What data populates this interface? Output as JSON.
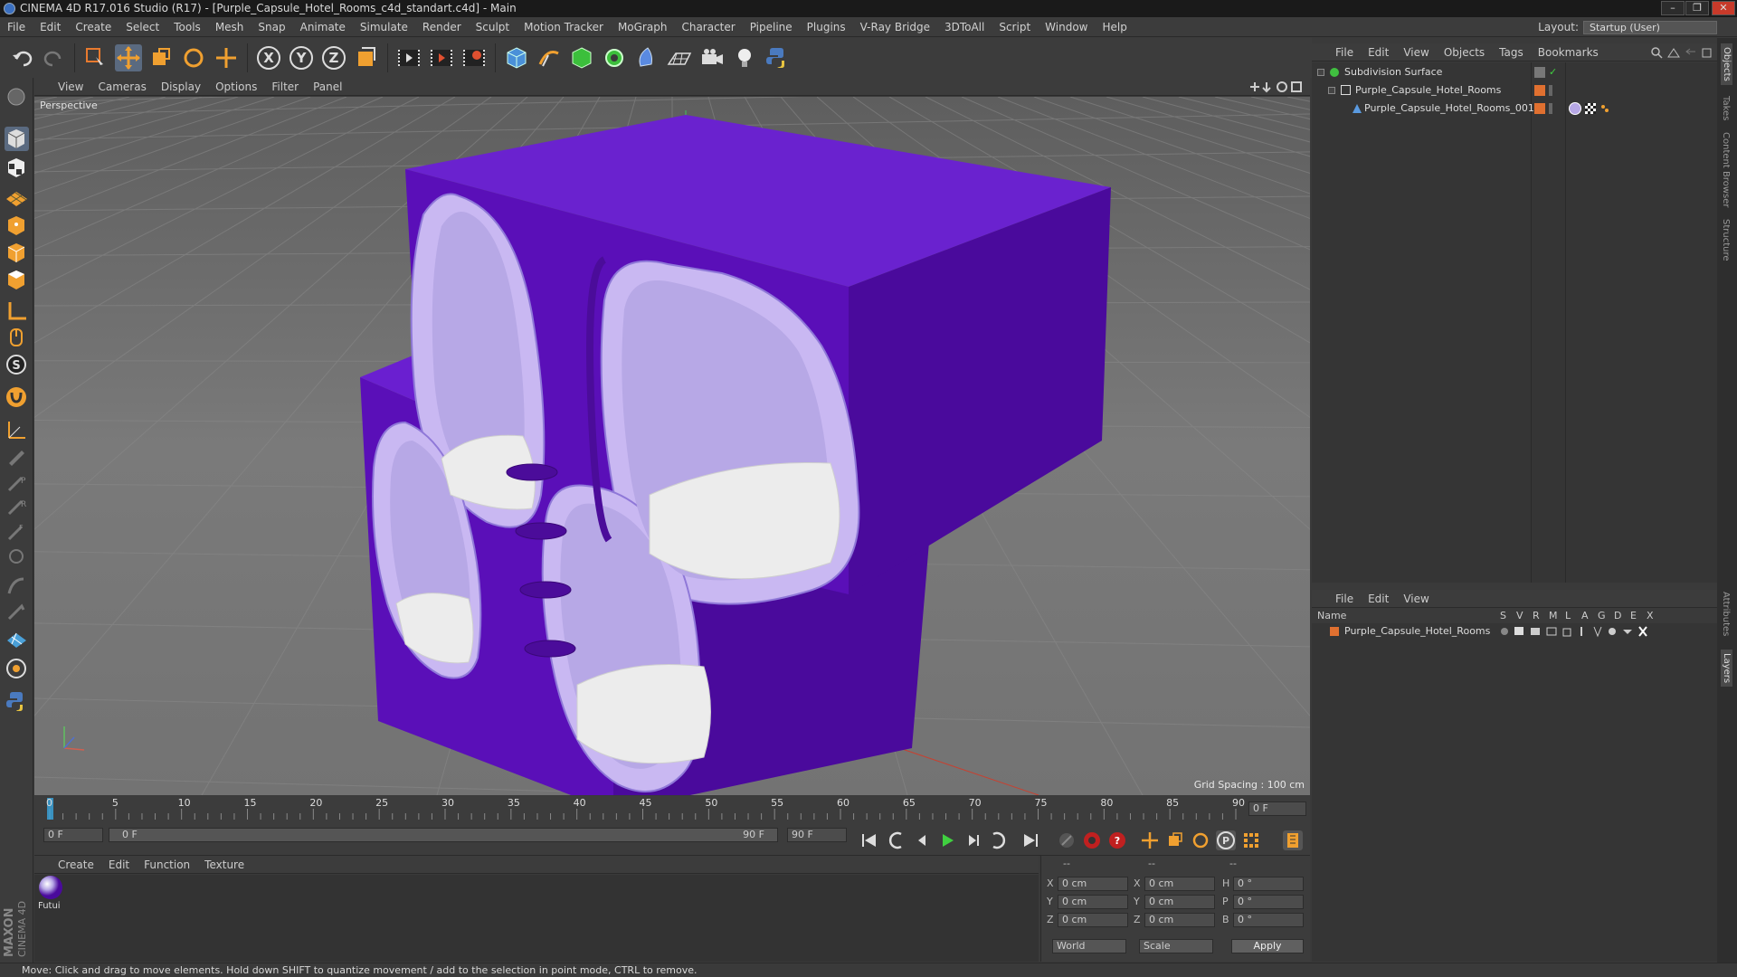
{
  "window": {
    "title": "CINEMA 4D R17.016 Studio (R17) - [Purple_Capsule_Hotel_Rooms_c4d_standart.c4d] - Main",
    "controls": [
      "–",
      "❐",
      "✕"
    ]
  },
  "menubar": {
    "items": [
      "File",
      "Edit",
      "Create",
      "Select",
      "Tools",
      "Mesh",
      "Snap",
      "Animate",
      "Simulate",
      "Render",
      "Sculpt",
      "Motion Tracker",
      "MoGraph",
      "Character",
      "Pipeline",
      "Plugins",
      "V-Ray Bridge",
      "3DToAll",
      "Script",
      "Window",
      "Help"
    ],
    "layout_label": "Layout:",
    "layout_value": "Startup (User)"
  },
  "toolbar": {
    "axis_labels": [
      "X",
      "Y",
      "Z"
    ]
  },
  "viewport": {
    "menu": [
      "View",
      "Cameras",
      "Display",
      "Options",
      "Filter",
      "Panel"
    ],
    "label": "Perspective",
    "grid_spacing": "Grid Spacing : 100 cm",
    "model_color": "#5a0fb8",
    "ring_color": "#c9b8f2"
  },
  "timeline": {
    "ticks": [
      "0",
      "5",
      "10",
      "15",
      "20",
      "25",
      "30",
      "35",
      "40",
      "45",
      "50",
      "55",
      "60",
      "65",
      "70",
      "75",
      "80",
      "85",
      "90"
    ],
    "current_frame": "0 F",
    "start_frame": "0 F",
    "range_start": "0 F",
    "range_end": "90 F",
    "end_frame": "90 F"
  },
  "material_manager": {
    "menu": [
      "Create",
      "Edit",
      "Function",
      "Texture"
    ],
    "material_name": "Futui"
  },
  "coordinates": {
    "headers": [
      "--",
      "--",
      "--"
    ],
    "rows": [
      {
        "a": "X",
        "av": "0 cm",
        "b": "X",
        "bv": "0 cm",
        "c": "H",
        "cv": "0 °"
      },
      {
        "a": "Y",
        "av": "0 cm",
        "b": "Y",
        "bv": "0 cm",
        "c": "P",
        "cv": "0 °"
      },
      {
        "a": "Z",
        "av": "0 cm",
        "b": "Z",
        "bv": "0 cm",
        "c": "B",
        "cv": "0 °"
      }
    ],
    "mode": "World",
    "scale": "Scale",
    "apply": "Apply"
  },
  "object_manager": {
    "menu": [
      "File",
      "Edit",
      "View",
      "Objects",
      "Tags",
      "Bookmarks"
    ],
    "objects": [
      "Subdivision Surface",
      "Purple_Capsule_Hotel_Rooms",
      "Purple_Capsule_Hotel_Rooms_001"
    ]
  },
  "layer_manager": {
    "menu": [
      "File",
      "Edit",
      "View"
    ],
    "columns": [
      "Name",
      "S",
      "V",
      "R",
      "M",
      "L",
      "A",
      "G",
      "D",
      "E",
      "X"
    ],
    "layer_name": "Purple_Capsule_Hotel_Rooms"
  },
  "side_tabs": [
    "Objects",
    "Takes",
    "Content Browser",
    "Structure",
    "Attributes",
    "Layers"
  ],
  "status": {
    "text": "Move: Click and drag to move elements. Hold down SHIFT to quantize movement / add to the selection in point mode, CTRL to remove."
  }
}
